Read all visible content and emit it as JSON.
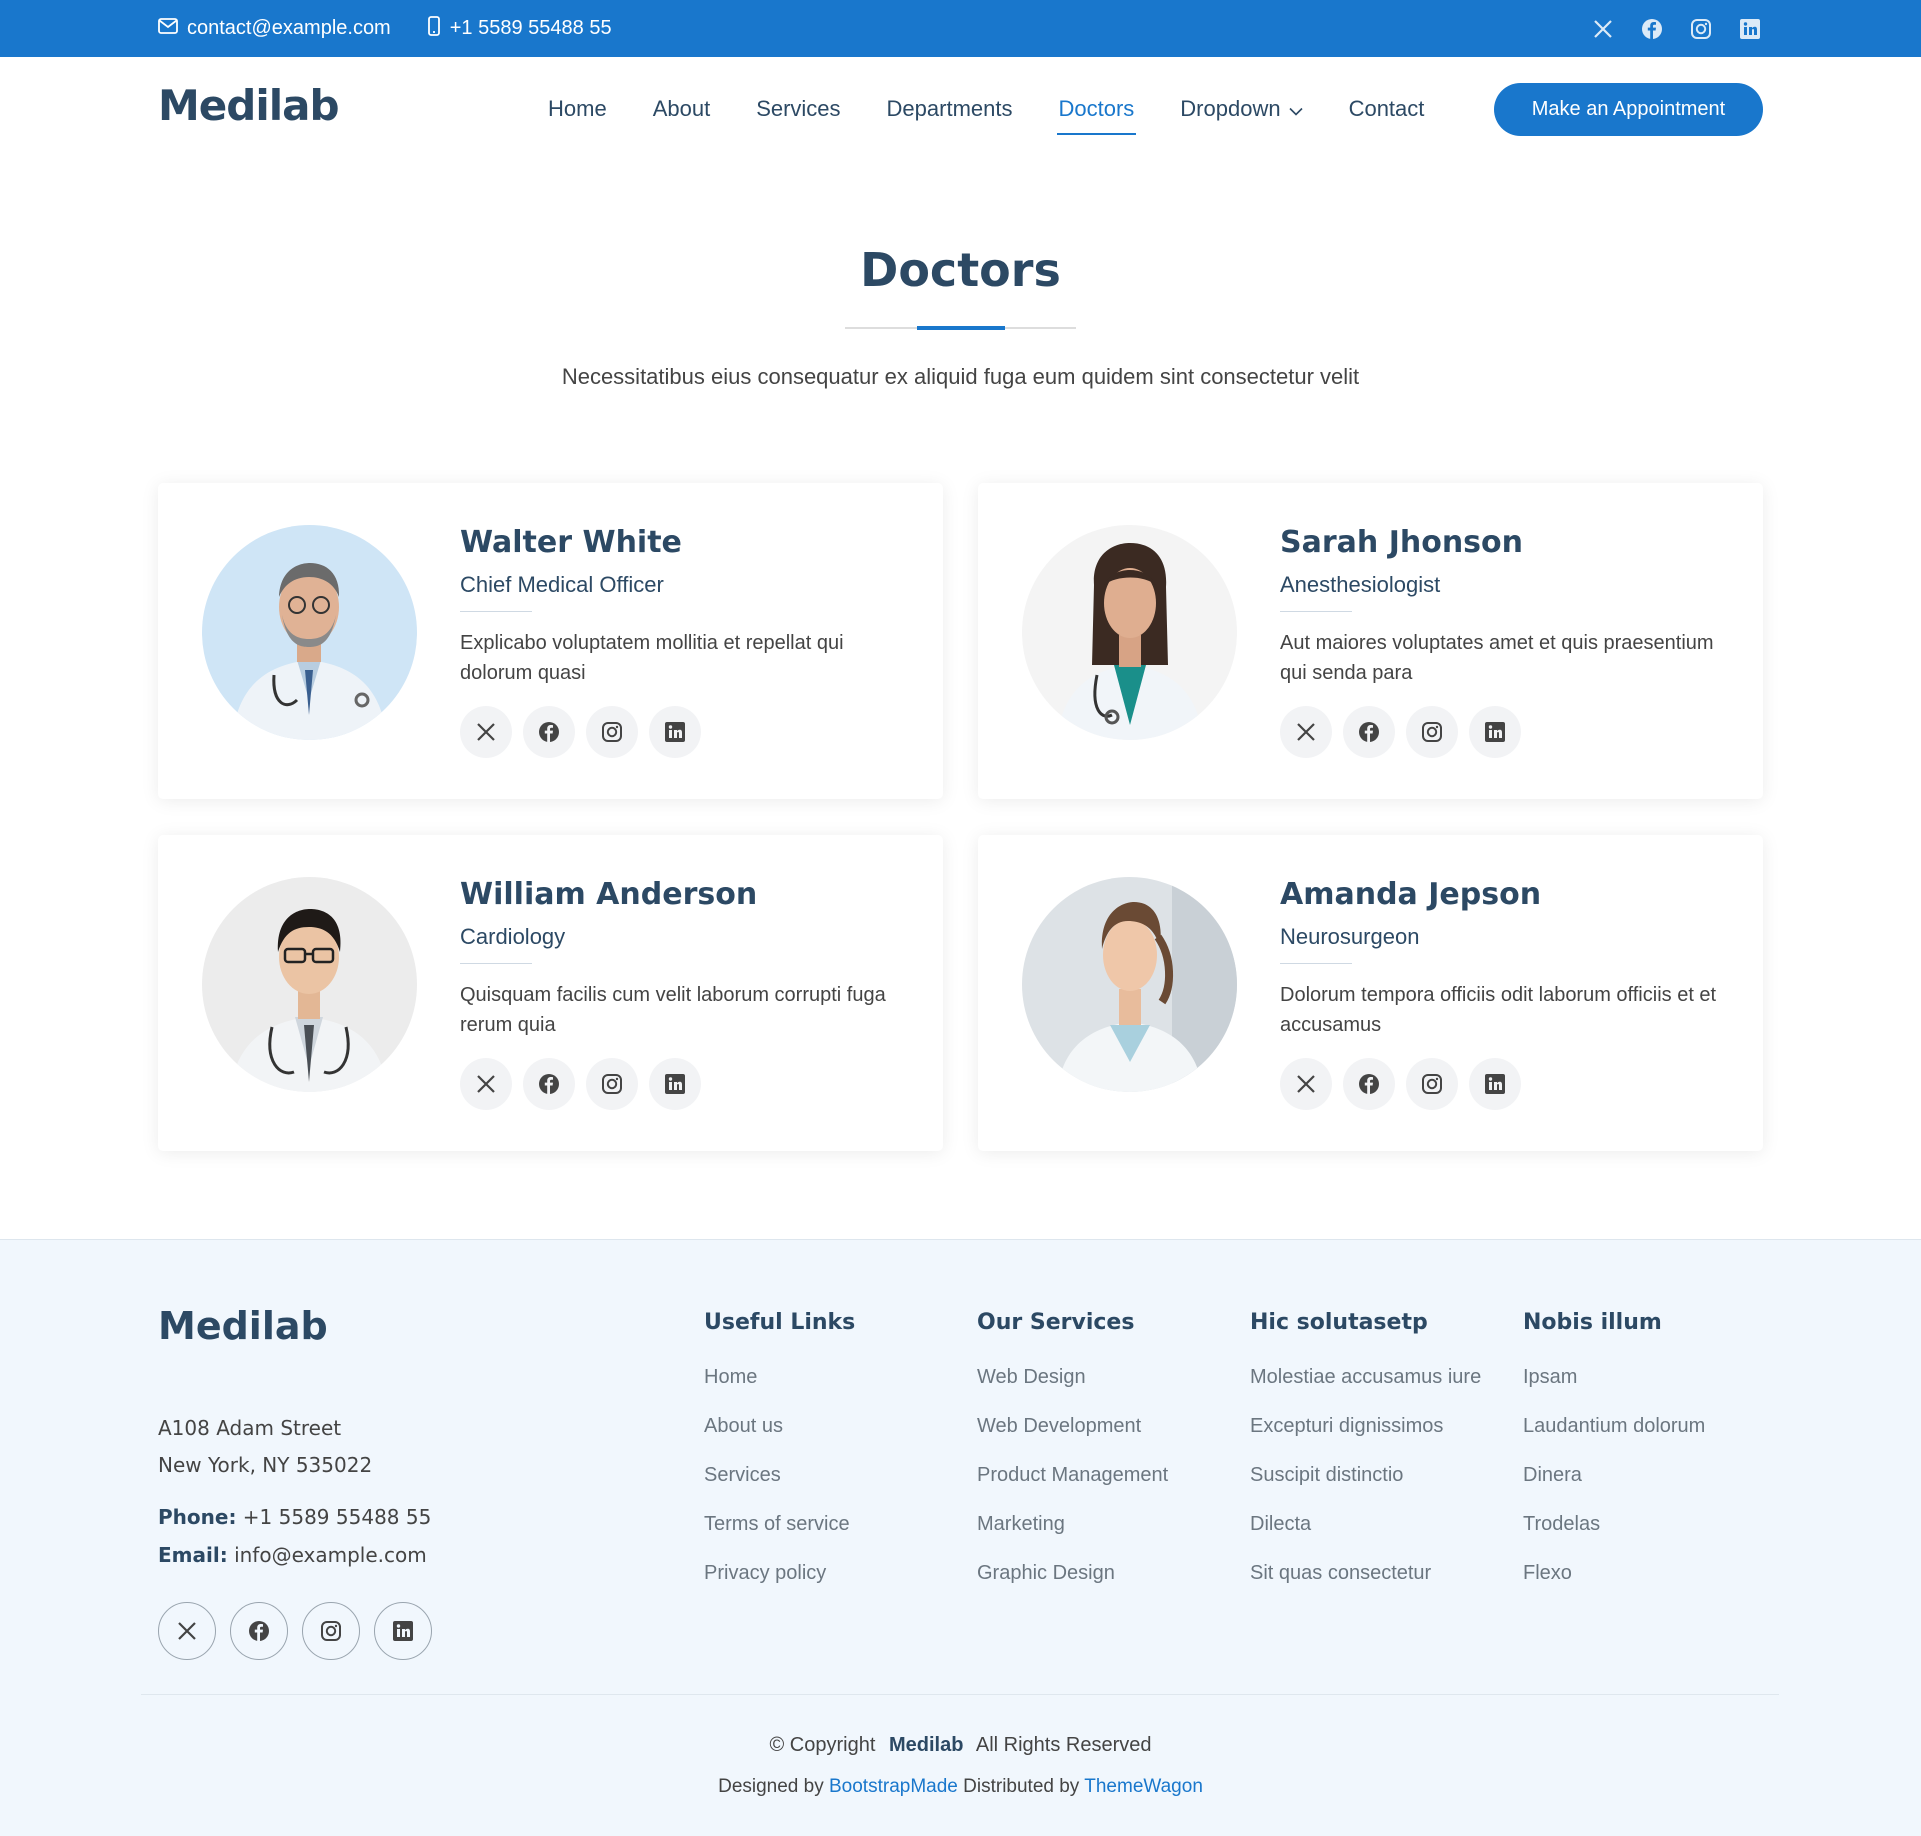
{
  "topbar": {
    "email": "contact@example.com",
    "phone": "+1 5589 55488 55",
    "social_icons": [
      "x-icon",
      "facebook-icon",
      "instagram-icon",
      "linkedin-icon"
    ]
  },
  "header": {
    "logo": "Medilab",
    "nav": [
      {
        "label": "Home"
      },
      {
        "label": "About"
      },
      {
        "label": "Services"
      },
      {
        "label": "Departments"
      },
      {
        "label": "Doctors",
        "active": true
      },
      {
        "label": "Dropdown",
        "has_dropdown": true
      },
      {
        "label": "Contact"
      }
    ],
    "cta": "Make an Appointment"
  },
  "section": {
    "title": "Doctors",
    "subtitle": "Necessitatibus eius consequatur ex aliquid fuga eum quidem sint consectetur velit"
  },
  "doctors": [
    {
      "name": "Walter White",
      "role": "Chief Medical Officer",
      "desc": "Explicabo voluptatem mollitia et repellat qui dolorum quasi"
    },
    {
      "name": "Sarah Jhonson",
      "role": "Anesthesiologist",
      "desc": "Aut maiores voluptates amet et quis praesentium qui senda para"
    },
    {
      "name": "William Anderson",
      "role": "Cardiology",
      "desc": "Quisquam facilis cum velit laborum corrupti fuga rerum quia"
    },
    {
      "name": "Amanda Jepson",
      "role": "Neurosurgeon",
      "desc": "Dolorum tempora officiis odit laborum officiis et et accusamus"
    }
  ],
  "footer": {
    "logo": "Medilab",
    "address_line1": "A108 Adam Street",
    "address_line2": "New York, NY 535022",
    "phone_label": "Phone:",
    "phone": "+1 5589 55488 55",
    "email_label": "Email:",
    "email": "info@example.com",
    "columns": [
      {
        "title": "Useful Links",
        "links": [
          "Home",
          "About us",
          "Services",
          "Terms of service",
          "Privacy policy"
        ]
      },
      {
        "title": "Our Services",
        "links": [
          "Web Design",
          "Web Development",
          "Product Management",
          "Marketing",
          "Graphic Design"
        ]
      },
      {
        "title": "Hic solutasetp",
        "links": [
          "Molestiae accusamus iure",
          "Excepturi dignissimos",
          "Suscipit distinctio",
          "Dilecta",
          "Sit quas consectetur"
        ]
      },
      {
        "title": "Nobis illum",
        "links": [
          "Ipsam",
          "Laudantium dolorum",
          "Dinera",
          "Trodelas",
          "Flexo"
        ]
      }
    ],
    "copyright_prefix": "© Copyright",
    "copyright_brand": "Medilab",
    "copyright_suffix": "All Rights Reserved",
    "designed_by": "Designed by",
    "designer": "BootstrapMade",
    "distributed_by": "Distributed by",
    "distributor": "ThemeWagon"
  },
  "colors": {
    "accent": "#1977cc",
    "heading": "#2c4964",
    "footer_bg": "#f1f7fd"
  }
}
